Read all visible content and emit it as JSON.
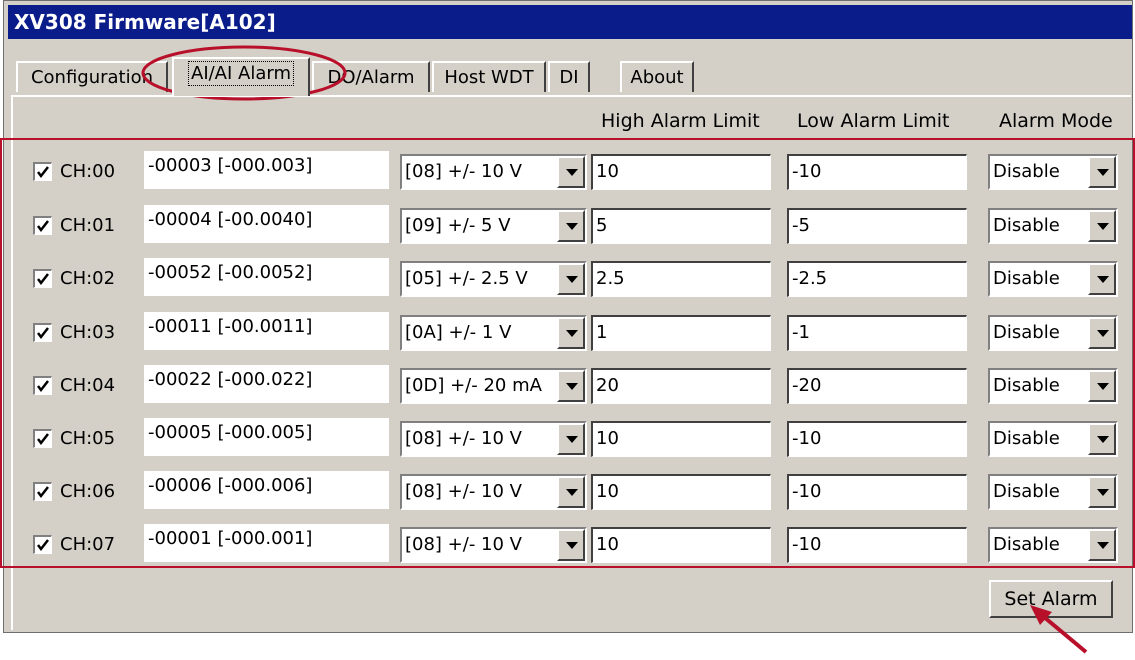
{
  "window": {
    "title": "XV308 Firmware[A102]"
  },
  "tabs": [
    "Configuration",
    "AI/AI Alarm",
    "DO/Alarm",
    "Host WDT",
    "DI",
    "About"
  ],
  "active_tab": "AI/AI Alarm",
  "headers": {
    "high": "High Alarm Limit",
    "low": "Low Alarm Limit",
    "mode": "Alarm Mode"
  },
  "channels": [
    {
      "label": "CH:00",
      "checked": true,
      "value": "-00003 [-000.003]",
      "range": "[08] +/- 10 V",
      "high": "10",
      "low": "-10",
      "mode": "Disable"
    },
    {
      "label": "CH:01",
      "checked": true,
      "value": "-00004 [-00.0040]",
      "range": "[09] +/- 5 V",
      "high": "5",
      "low": "-5",
      "mode": "Disable"
    },
    {
      "label": "CH:02",
      "checked": true,
      "value": "-00052 [-00.0052]",
      "range": "[05] +/- 2.5 V",
      "high": "2.5",
      "low": "-2.5",
      "mode": "Disable"
    },
    {
      "label": "CH:03",
      "checked": true,
      "value": "-00011 [-00.0011]",
      "range": "[0A] +/- 1 V",
      "high": "1",
      "low": "-1",
      "mode": "Disable"
    },
    {
      "label": "CH:04",
      "checked": true,
      "value": "-00022 [-000.022]",
      "range": "[0D] +/- 20 mA",
      "high": "20",
      "low": "-20",
      "mode": "Disable"
    },
    {
      "label": "CH:05",
      "checked": true,
      "value": "-00005 [-000.005]",
      "range": "[08] +/- 10 V",
      "high": "10",
      "low": "-10",
      "mode": "Disable"
    },
    {
      "label": "CH:06",
      "checked": true,
      "value": "-00006 [-000.006]",
      "range": "[08] +/- 10 V",
      "high": "10",
      "low": "-10",
      "mode": "Disable"
    },
    {
      "label": "CH:07",
      "checked": true,
      "value": "-00001 [-000.001]",
      "range": "[08] +/- 10 V",
      "high": "10",
      "low": "-10",
      "mode": "Disable"
    }
  ],
  "set_alarm_label": "Set Alarm",
  "colors": {
    "title_bar": "#0a1b8a",
    "highlight": "#b8102a",
    "face": "#d4d0c8"
  }
}
